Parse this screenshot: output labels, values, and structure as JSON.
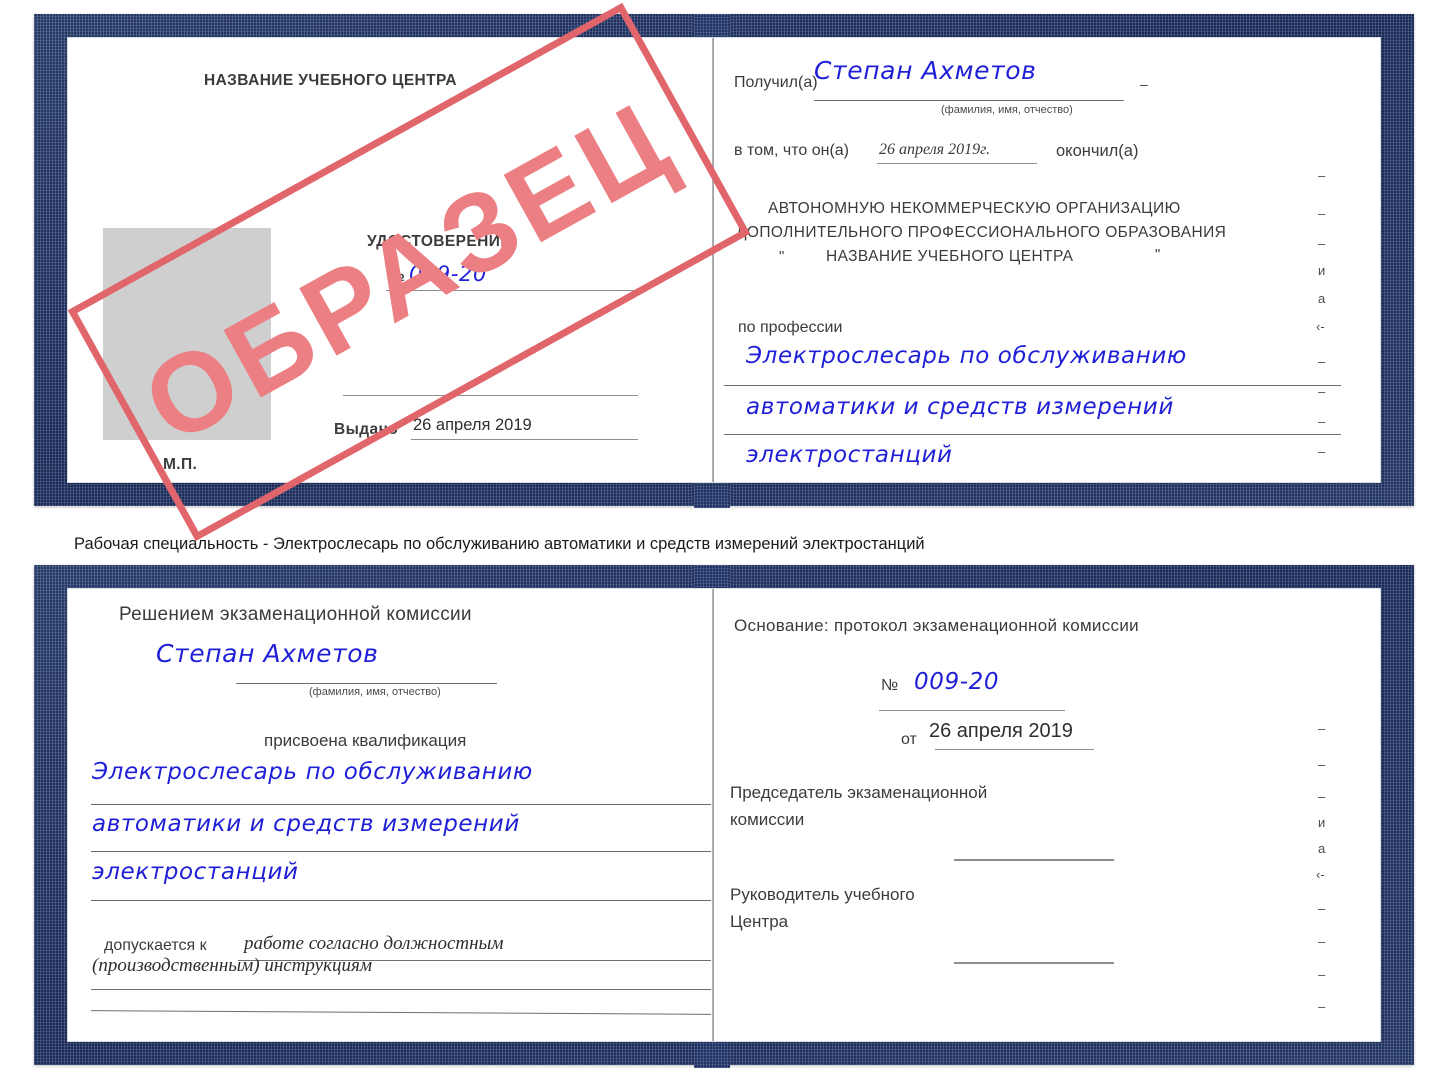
{
  "colors": {
    "cover_blue": "#2a417b",
    "handwriting_blue": "#1f1fd8",
    "stamp_red": "#e1666c",
    "stamp_text_red": "#ec7f84",
    "photo_gray": "#cfcfcf",
    "rule_gray": "#8e8e8e"
  },
  "stamp": {
    "label": "ОБРАЗЕЦ"
  },
  "caption": {
    "text": "Рабочая специальность - Электрослесарь по обслуживанию автоматики и средств измерений электростанций"
  },
  "certificate_top": {
    "left_page": {
      "center_name": "НАЗВАНИЕ УЧЕБНОГО ЦЕНТРА",
      "doc_title": "УДОСТОВЕРЕНИЕ",
      "number_label": "№",
      "number_value": "009-20",
      "issued_label": "Выдано",
      "issued_value": "26 апреля 2019",
      "seal_label": "М.П."
    },
    "right_page": {
      "received_label": "Получил(а)",
      "received_value": "Степан Ахметов",
      "fio_hint": "(фамилия, имя, отчество)",
      "fact_label": "в том, что он(а)",
      "fact_date": "26 апреля 2019г.",
      "fact_label_tail": "окончил(а)",
      "org_line1": "АВТОНОМНУЮ НЕКОММЕРЧЕСКУЮ ОРГАНИЗАЦИЮ",
      "org_line2": "ДОПОЛНИТЕЛЬНОГО ПРОФЕССИОНАЛЬНОГО ОБРАЗОВАНИЯ",
      "org_quote_open": "\"",
      "org_line3": "НАЗВАНИЕ УЧЕБНОГО ЦЕНТРА",
      "org_quote_close": "\"",
      "profession_label": "по профессии",
      "profession_line1": "Электрослесарь по обслуживанию",
      "profession_line2": "автоматики и средств измерений",
      "profession_line3": "электростанций",
      "edge_fragments": [
        "–",
        "–",
        "–",
        "и",
        "а",
        "‹-",
        "–",
        "–",
        "–",
        "–"
      ]
    }
  },
  "certificate_bottom": {
    "left_page": {
      "decision_title": "Решением экзаменационной комиссии",
      "name_value": "Степан Ахметов",
      "fio_hint": "(фамилия, имя, отчество)",
      "qualification_label": "присвоена квалификация",
      "qualification_line1": "Электрослесарь по обслуживанию",
      "qualification_line2": "автоматики и средств измерений",
      "qualification_line3": "электростанций",
      "admitted_label": "допускается к",
      "admitted_line1": "работе согласно должностным",
      "admitted_line2": "(производственным) инструкциям"
    },
    "right_page": {
      "basis_label": "Основание: протокол экзаменационной комиссии",
      "number_label": "№",
      "number_value": "009-20",
      "date_label": "от",
      "date_value": "26 апреля 2019",
      "chair_line1": "Председатель экзаменационной",
      "chair_line2": "комиссии",
      "head_line1": "Руководитель учебного",
      "head_line2": "Центра",
      "edge_fragments": [
        "–",
        "–",
        "–",
        "и",
        "а",
        "‹-",
        "–",
        "–",
        "–",
        "–"
      ]
    }
  }
}
